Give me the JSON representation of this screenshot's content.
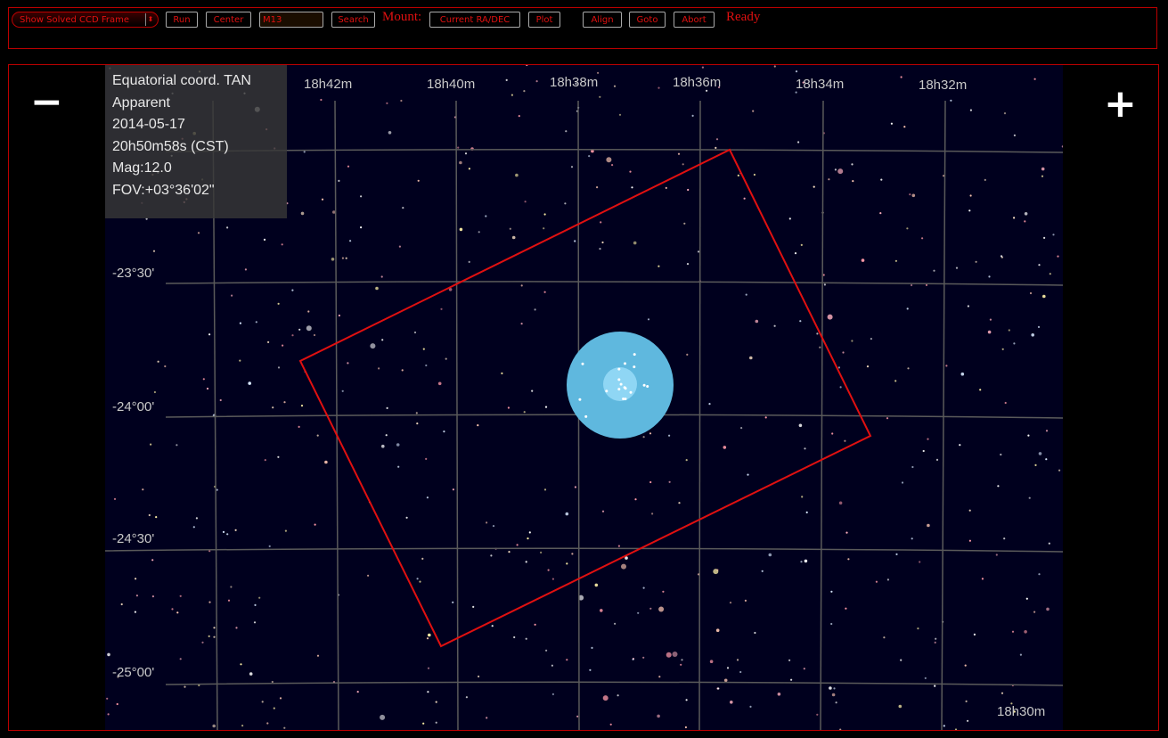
{
  "toolbar": {
    "frame_select": "Show Solved CCD Frame",
    "run": "Run",
    "center": "Center",
    "target_value": "M13",
    "search": "Search",
    "mount_label": "Mount:",
    "mount_select": "Current RA/DEC",
    "plot": "Plot",
    "align": "Align",
    "goto": "Goto",
    "abort": "Abort",
    "status": "Ready"
  },
  "info": {
    "projection": "Equatorial coord. TAN",
    "mode": "Apparent",
    "date": "2014-05-17",
    "time": "20h50m58s (CST)",
    "magnitude": "Mag:12.0",
    "fov": "FOV:+03°36'02\""
  },
  "ra_labels": [
    "18h42m",
    "18h40m",
    "18h38m",
    "18h36m",
    "18h34m",
    "18h32m",
    "18h30m"
  ],
  "dec_labels": [
    "-23°30'",
    "-24°00'",
    "-24°30'",
    "-25°00'"
  ],
  "zoom": {
    "out": "−",
    "in": "+"
  },
  "colors": {
    "accent": "#e01010",
    "sky_background": "#00001e",
    "grid": "#5a5a5a",
    "ccd_frame": "#e01010",
    "object_marker": "#5fb8de"
  }
}
